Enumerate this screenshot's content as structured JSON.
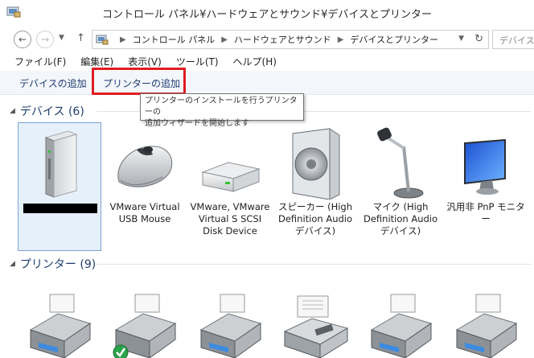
{
  "window": {
    "title": "コントロール パネル¥ハードウェアとサウンド¥デバイスとプリンター"
  },
  "address": {
    "crumbs": [
      "コントロール パネル",
      "ハードウェアとサウンド",
      "デバイスとプリンター"
    ],
    "search_placeholder": "デバイスとプ"
  },
  "menu": {
    "file": "ファイル(F)",
    "edit": "編集(E)",
    "view": "表示(V)",
    "tools": "ツール(T)",
    "help": "ヘルプ(H)"
  },
  "commands": {
    "add_device": "デバイスの追加",
    "add_printer": "プリンターの追加"
  },
  "tooltip": {
    "line1": "プリンターのインストールを行うプリンターの",
    "line2": "追加ウィザードを開始します"
  },
  "groups": {
    "devices": "デバイス (6)",
    "printers": "プリンター (9)"
  },
  "devices": [
    {
      "label": ""
    },
    {
      "label": "VMware Virtual USB Mouse"
    },
    {
      "label": "VMware, VMware Virtual S SCSI Disk Device"
    },
    {
      "label": "スピーカー (High Definition Audio デバイス)"
    },
    {
      "label": "マイク (High Definition Audio デバイス)"
    },
    {
      "label": "汎用非 PnP モニター"
    }
  ],
  "icons": {
    "back": "back-arrow-icon",
    "forward": "forward-arrow-icon",
    "up": "up-arrow-icon",
    "refresh": "refresh-icon"
  }
}
